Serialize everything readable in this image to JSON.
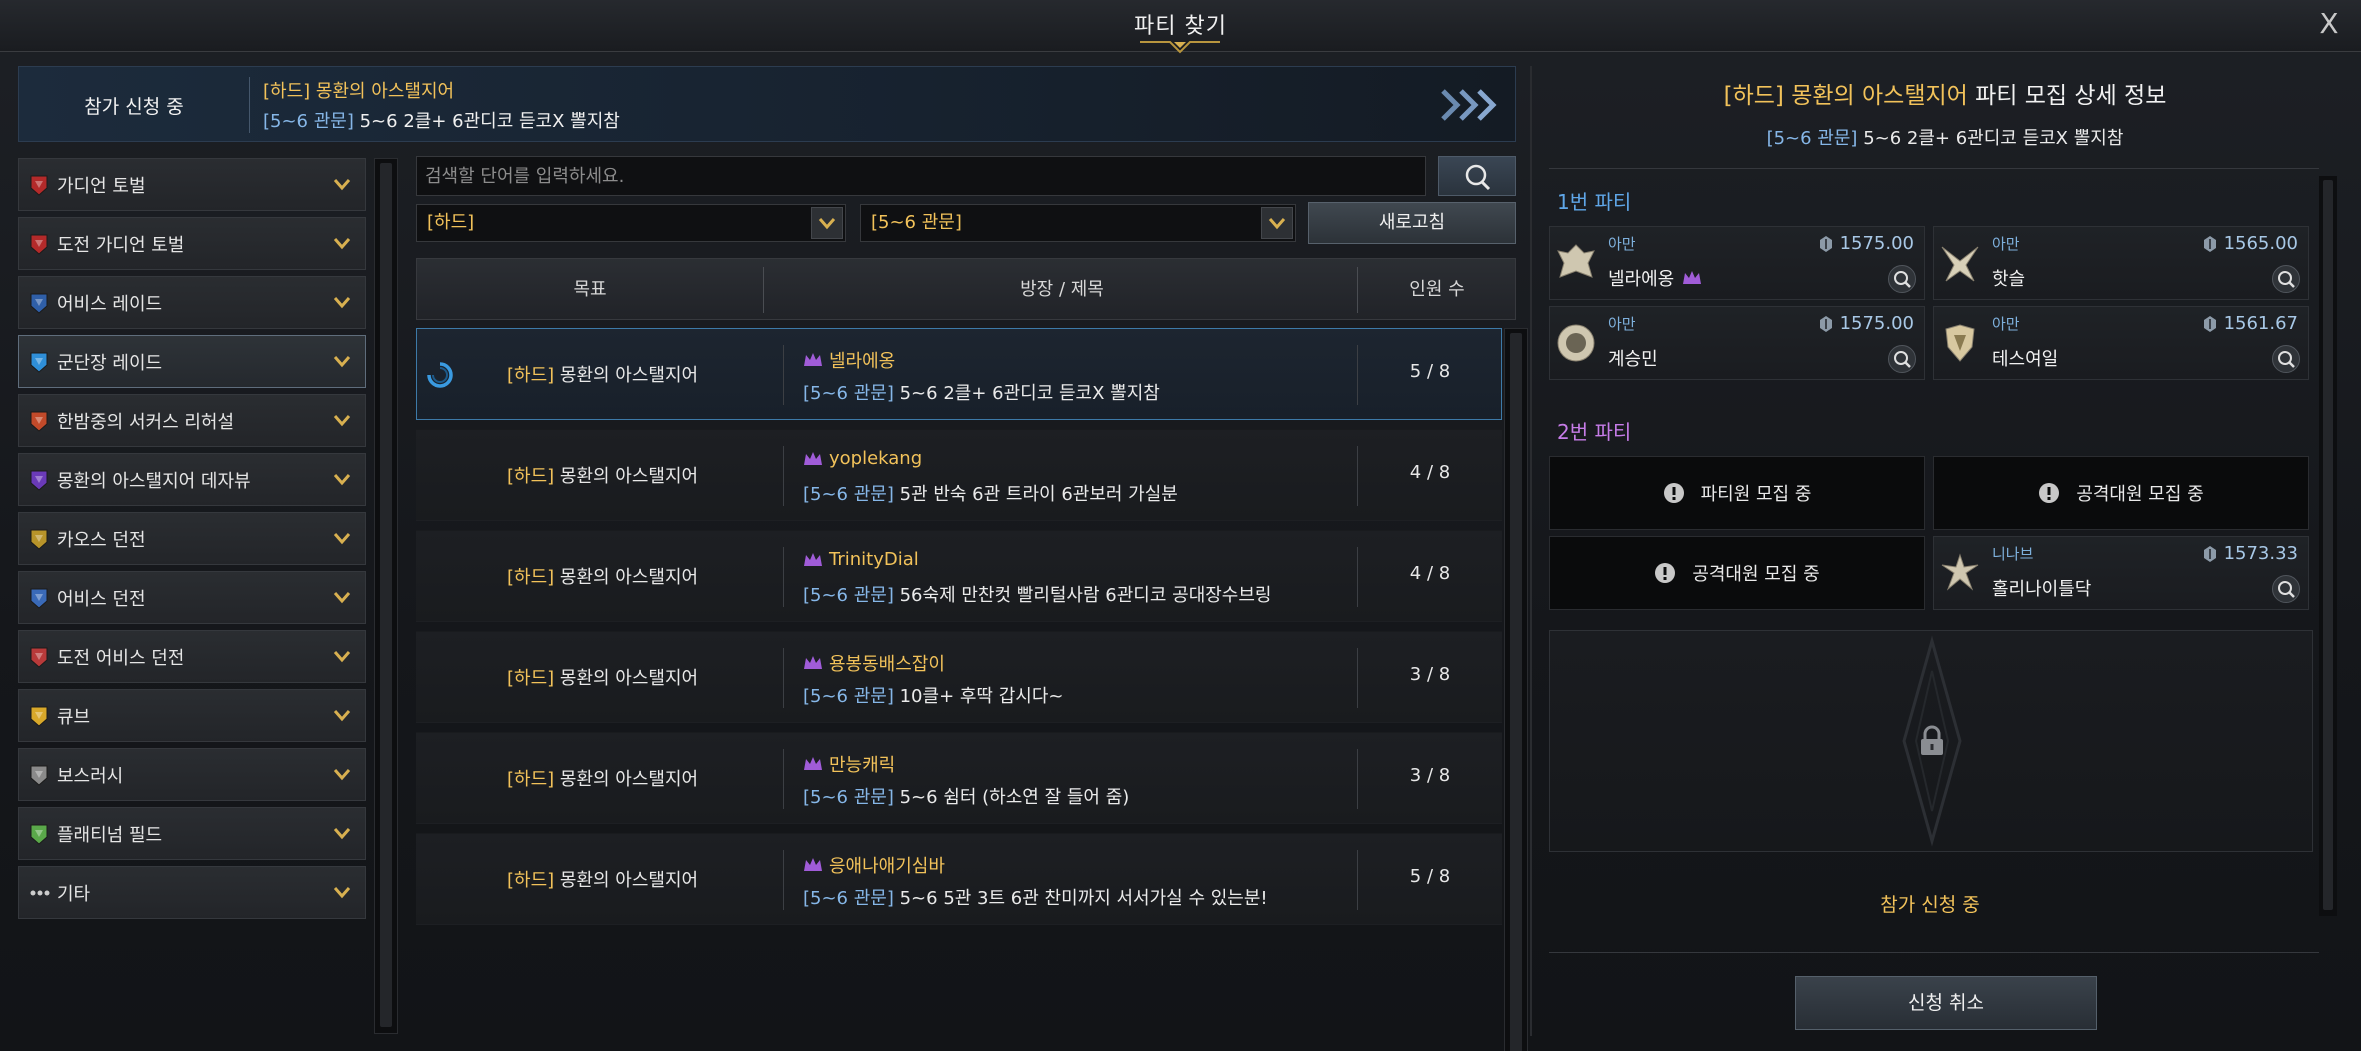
{
  "window": {
    "title": "파티 찾기",
    "close_label": "X"
  },
  "banner": {
    "status": "참가 신청 중",
    "difficulty_tag": "[하드]",
    "target": "몽환의 아스탤지어",
    "gate_tag": "[5~6 관문]",
    "desc": "5~6 2클+ 6관디코 듣코X 뽈지참"
  },
  "categories": [
    {
      "label": "가디언 토벌",
      "icon": "guardian-icon",
      "color": "#b32a2a"
    },
    {
      "label": "도전 가디언 토벌",
      "icon": "challenge-guardian-icon",
      "color": "#b32a2a"
    },
    {
      "label": "어비스 레이드",
      "icon": "abyss-raid-icon",
      "color": "#2f5fa8"
    },
    {
      "label": "군단장 레이드",
      "icon": "legion-raid-icon",
      "color": "#2f8fd8"
    },
    {
      "label": "한밤중의 서커스 리허설",
      "icon": "circus-icon",
      "color": "#c24a2a"
    },
    {
      "label": "몽환의 아스탤지어 데자뷰",
      "icon": "dejavu-icon",
      "color": "#6a3ab8"
    },
    {
      "label": "카오스 던전",
      "icon": "chaos-dungeon-icon",
      "color": "#b8942a"
    },
    {
      "label": "어비스 던전",
      "icon": "abyss-dungeon-icon",
      "color": "#3a6ab8"
    },
    {
      "label": "도전 어비스 던전",
      "icon": "challenge-abyss-icon",
      "color": "#b83a3a"
    },
    {
      "label": "큐브",
      "icon": "cube-icon",
      "color": "#d8a82a"
    },
    {
      "label": "보스러시",
      "icon": "boss-rush-icon",
      "color": "#8a8a8a"
    },
    {
      "label": "플래티넘 필드",
      "icon": "platinum-field-icon",
      "color": "#5aa84a"
    },
    {
      "label": "기타",
      "icon": "more-icon",
      "color": "#cccccc"
    }
  ],
  "search": {
    "placeholder": "검색할 단어를 입력하세요.",
    "value": ""
  },
  "filters": {
    "difficulty": "[하드]",
    "gate": "[5~6 관문]",
    "refresh_label": "새로고침"
  },
  "table": {
    "columns": [
      "목표",
      "방장 / 제목",
      "인원 수"
    ],
    "rows": [
      {
        "diff": "[하드]",
        "target": "몽환의 아스탤지어",
        "leader": "넬라에옹",
        "gate": "[5~6 관문]",
        "title": "5~6 2클+ 6관디코 듣코X 뽈지참",
        "count": "5 / 8"
      },
      {
        "diff": "[하드]",
        "target": "몽환의 아스탤지어",
        "leader": "yoplekang",
        "gate": "[5~6 관문]",
        "title": "5관 반숙 6관 트라이 6관보러 가실분",
        "count": "4 / 8"
      },
      {
        "diff": "[하드]",
        "target": "몽환의 아스탤지어",
        "leader": "TrinityDial",
        "gate": "[5~6 관문]",
        "title": "56숙제 만찬컷 빨리털사람 6관디코 공대장수브링",
        "count": "4 / 8"
      },
      {
        "diff": "[하드]",
        "target": "몽환의 아스탤지어",
        "leader": "용봉동배스잡이",
        "gate": "[5~6 관문]",
        "title": "10클+ 후딱 갑시다~",
        "count": "3 / 8"
      },
      {
        "diff": "[하드]",
        "target": "몽환의 아스탤지어",
        "leader": "만능캐릭",
        "gate": "[5~6 관문]",
        "title": "5~6 쉼터 (하소연 잘 들어 줌)",
        "count": "3 / 8"
      },
      {
        "diff": "[하드]",
        "target": "몽환의 아스탤지어",
        "leader": "응애나애기심바",
        "gate": "[5~6 관문]",
        "title": "5~6 5관 3트 6관 찬미까지 서서가실 수 있는분!",
        "count": "5 / 8"
      }
    ]
  },
  "detail": {
    "diff": "[하드]",
    "target": "몽환의 아스탤지어",
    "title_suffix": "파티 모집 상세 정보",
    "gate": "[5~6 관문]",
    "desc": "5~6 2클+ 6관디코 듣코X 뽈지참",
    "party1_label": "1번 파티",
    "party2_label": "2번 파티",
    "party1": [
      {
        "class": "아만",
        "name": "넬라에옹",
        "ilvl": "1575.00",
        "leader": true
      },
      {
        "class": "아만",
        "name": "핫슬",
        "ilvl": "1565.00",
        "leader": false
      },
      {
        "class": "아만",
        "name": "계승민",
        "ilvl": "1575.00",
        "leader": false
      },
      {
        "class": "아만",
        "name": "테스여일",
        "ilvl": "1561.67",
        "leader": false
      }
    ],
    "party2_recruit": [
      "파티원 모집 중",
      "공격대원 모집 중",
      "공격대원 모집 중"
    ],
    "party2_member": {
      "class": "니나브",
      "name": "홀리나이틀닥",
      "ilvl": "1573.33"
    },
    "status": "참가 신청 중",
    "cancel_label": "신청 취소"
  },
  "colors": {
    "accent_gold": "#f2c25a",
    "tag_blue": "#86b7e8",
    "party1": "#5fa6e8",
    "party2": "#c67ce8"
  }
}
